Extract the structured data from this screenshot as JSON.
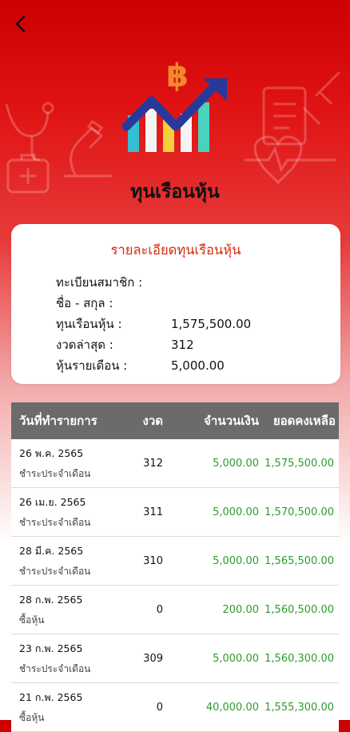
{
  "header": {
    "title": "ทุนเรือนหุ้น",
    "back_icon": "chevron-left-icon",
    "logo": "baht-chart-logo-icon"
  },
  "colors": {
    "header_red": "#cc0000",
    "card_title": "#d42a0e",
    "amount_green": "#2c9c2c",
    "table_header_bg": "#6b6b6b"
  },
  "details": {
    "title": "รายละเอียดทุนเรือนหุ้น",
    "rows": [
      {
        "label": "ทะเบียนสมาชิก :",
        "value": ""
      },
      {
        "label": "ชื่อ - สกุล :",
        "value": ""
      },
      {
        "label": "ทุนเรือนหุ้น :",
        "value": "1,575,500.00"
      },
      {
        "label": "งวดล่าสุด :",
        "value": "312"
      },
      {
        "label": "หุ้นรายเดือน :",
        "value": "5,000.00"
      }
    ]
  },
  "table": {
    "headers": [
      "วันที่ทำรายการ",
      "งวด",
      "จำนวนเงิน",
      "ยอดคงเหลือ"
    ],
    "rows": [
      {
        "date": "26 พ.ค. 2565",
        "type": "ชำระประจำเดือน",
        "period": "312",
        "amount": "5,000.00",
        "balance": "1,575,500.00"
      },
      {
        "date": "26 เม.ย. 2565",
        "type": "ชำระประจำเดือน",
        "period": "311",
        "amount": "5,000.00",
        "balance": "1,570,500.00"
      },
      {
        "date": "28 มี.ค. 2565",
        "type": "ชำระประจำเดือน",
        "period": "310",
        "amount": "5,000.00",
        "balance": "1,565,500.00"
      },
      {
        "date": "28 ก.พ. 2565",
        "type": "ซื้อหุ้น",
        "period": "0",
        "amount": "200.00",
        "balance": "1,560,500.00"
      },
      {
        "date": "23 ก.พ. 2565",
        "type": "ชำระประจำเดือน",
        "period": "309",
        "amount": "5,000.00",
        "balance": "1,560,300.00"
      },
      {
        "date": "21 ก.พ. 2565",
        "type": "ซื้อหุ้น",
        "period": "0",
        "amount": "40,000.00",
        "balance": "1,555,300.00"
      }
    ]
  }
}
